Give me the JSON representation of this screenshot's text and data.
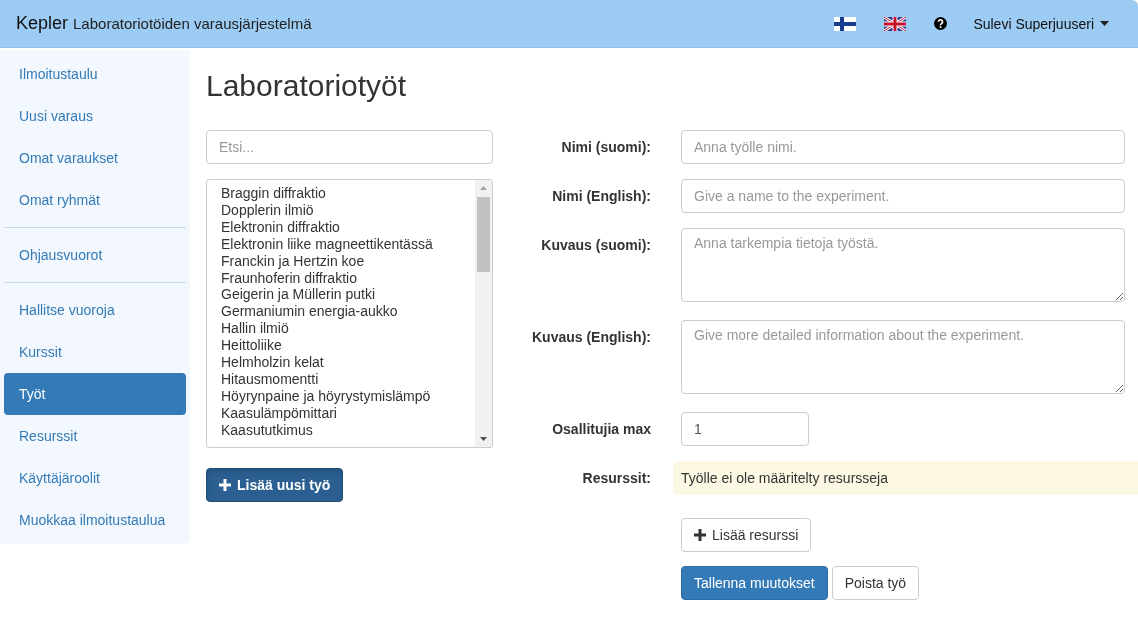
{
  "navbar": {
    "brand": "Kepler",
    "subtitle": "Laboratoriotöiden varausjärjestelmä",
    "languages": [
      {
        "kind": "fi"
      },
      {
        "kind": "en"
      }
    ],
    "user": "Sulevi Superjuuseri"
  },
  "sidebar": {
    "groups": [
      [
        {
          "label": "Ilmoitustaulu",
          "selected": false
        },
        {
          "label": "Uusi varaus",
          "selected": false
        },
        {
          "label": "Omat varaukset",
          "selected": false
        },
        {
          "label": "Omat ryhmät",
          "selected": false
        }
      ],
      [
        {
          "label": "Ohjausvuorot",
          "selected": false
        }
      ],
      [
        {
          "label": "Hallitse vuoroja",
          "selected": false
        },
        {
          "label": "Kurssit",
          "selected": false
        },
        {
          "label": "Työt",
          "selected": true
        },
        {
          "label": "Resurssit",
          "selected": false
        },
        {
          "label": "Käyttäjäroolit",
          "selected": false
        },
        {
          "label": "Muokkaa ilmoitustaulua",
          "selected": false
        }
      ]
    ]
  },
  "title": "Laboratoriotyöt",
  "search": {
    "placeholder": "Etsi..."
  },
  "works": [
    "Braggin diffraktio",
    "Dopplerin ilmiö",
    "Elektronin diffraktio",
    "Elektronin liike magneettikentässä",
    "Franckin ja Hertzin koe",
    "Fraunhoferin diffraktio",
    "Geigerin ja Müllerin putki",
    "Germaniumin energia-aukko",
    "Hallin ilmiö",
    "Heittoliike",
    "Helmholzin kelat",
    "Hitausmomentti",
    "Höyrynpaine ja höyrystymislämpö",
    "Kaasulämpömittari",
    "Kaasututkimus"
  ],
  "add_button": "Lisää uusi työ",
  "form": {
    "fields": [
      {
        "kind": "text",
        "label": "Nimi (suomi):",
        "placeholder": "Anna työlle nimi."
      },
      {
        "kind": "text",
        "label": "Nimi (English):",
        "placeholder": "Give a name to the experiment."
      },
      {
        "kind": "textarea",
        "label": "Kuvaus (suomi):",
        "placeholder": "Anna tarkempia tietoja työstä."
      },
      {
        "kind": "textarea",
        "label": "Kuvaus (English):",
        "placeholder": "Give more detailed information about the experiment."
      },
      {
        "kind": "number",
        "label": "Osallitujia max",
        "value": "1"
      }
    ],
    "resources": {
      "label": "Resurssit:",
      "message": "Työlle ei ole määritelty resursseja"
    },
    "add_resource": "Lisää resurssi",
    "save": "Tallenna muutokset",
    "delete": "Poista työ"
  }
}
